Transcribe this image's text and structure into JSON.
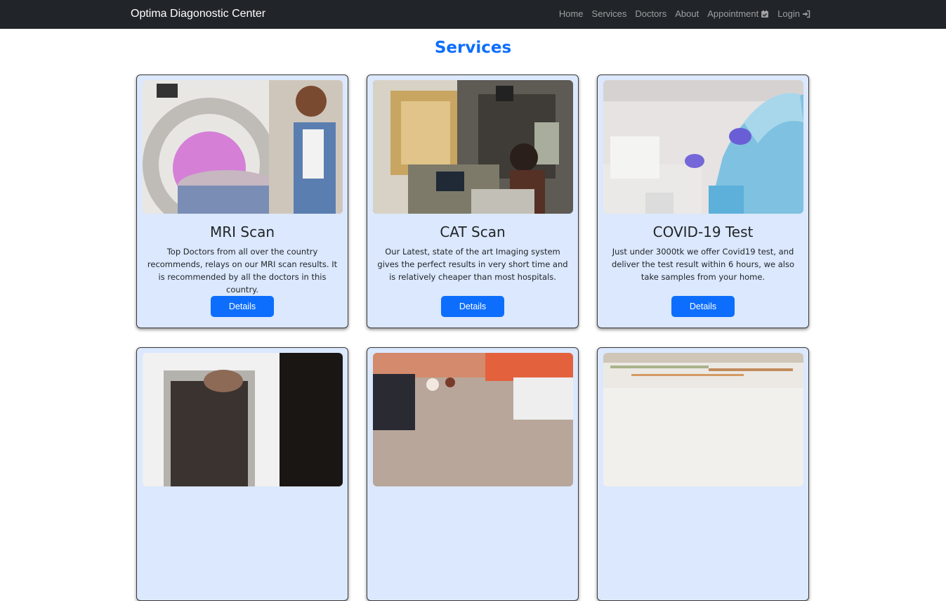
{
  "navbar": {
    "brand": "Optima Diagonostic Center",
    "links": [
      "Home",
      "Services",
      "Doctors",
      "About",
      "Appointment",
      "Login"
    ]
  },
  "page": {
    "title": "Services"
  },
  "services": [
    {
      "title": "MRI Scan",
      "description": "Top Doctors from all over the country recommends, relays on our MRI scan results. It is recommended by all the doctors in this country.",
      "button": "Details"
    },
    {
      "title": "CAT Scan",
      "description": "Our Latest, state of the art Imaging system gives the perfect results in very short time and is relatively cheaper than most hospitals.",
      "button": "Details"
    },
    {
      "title": "COVID-19 Test",
      "description": "Just under 3000tk we offer Covid19 test, and deliver the test result within 6 hours, we also take samples from your home.",
      "button": "Details"
    }
  ],
  "colors": {
    "navbar": "#212529",
    "accent": "#0d6efd",
    "card_bg": "#dbe8fd"
  }
}
